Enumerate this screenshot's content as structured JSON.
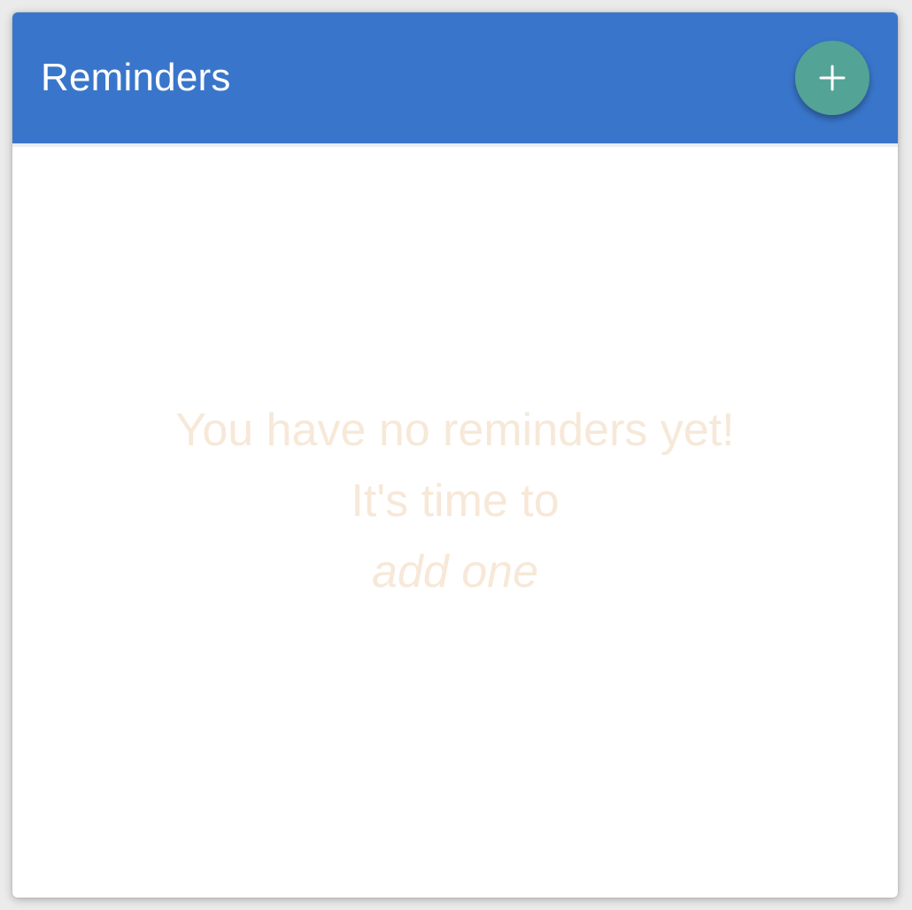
{
  "header": {
    "title": "Reminders",
    "add_icon": "plus-icon"
  },
  "empty_state": {
    "line1": "You have no reminders yet!",
    "line2": "It's time to",
    "link": "add one"
  },
  "colors": {
    "header_bg": "#3976cb",
    "fab_bg": "#53a396",
    "empty_text": "#f7e8d8",
    "card_bg": "#ffffff"
  }
}
